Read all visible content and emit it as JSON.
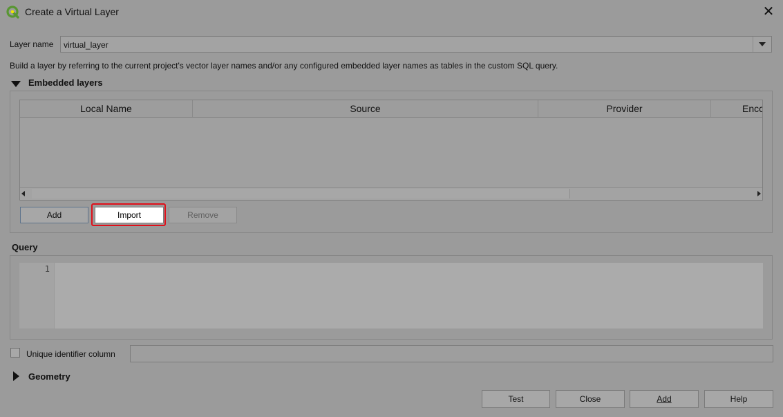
{
  "window": {
    "title": "Create a Virtual Layer",
    "app_icon": "qgis-logo-icon",
    "close_icon": "close-icon",
    "close_glyph": "✕"
  },
  "layer_name": {
    "label": "Layer name",
    "value": "virtual_layer"
  },
  "description": "Build a layer by referring to the current project's vector layer names and/or any configured embedded layer names as tables in the custom SQL query.",
  "embedded": {
    "title": "Embedded layers",
    "columns": [
      "Local Name",
      "Source",
      "Provider",
      "Encc"
    ],
    "rows": [],
    "buttons": {
      "add": "Add",
      "import": "Import",
      "remove": "Remove"
    }
  },
  "query": {
    "title": "Query",
    "line_number": "1",
    "text": ""
  },
  "unique_id": {
    "label": "Unique identifier column",
    "checked": false,
    "value": ""
  },
  "geometry": {
    "title": "Geometry"
  },
  "footer": {
    "test": "Test",
    "close": "Close",
    "add": "Add",
    "help": "Help"
  },
  "colors": {
    "highlight": "#e0101a",
    "qgis_green": "#589632",
    "qgis_yellow": "#eee600"
  }
}
